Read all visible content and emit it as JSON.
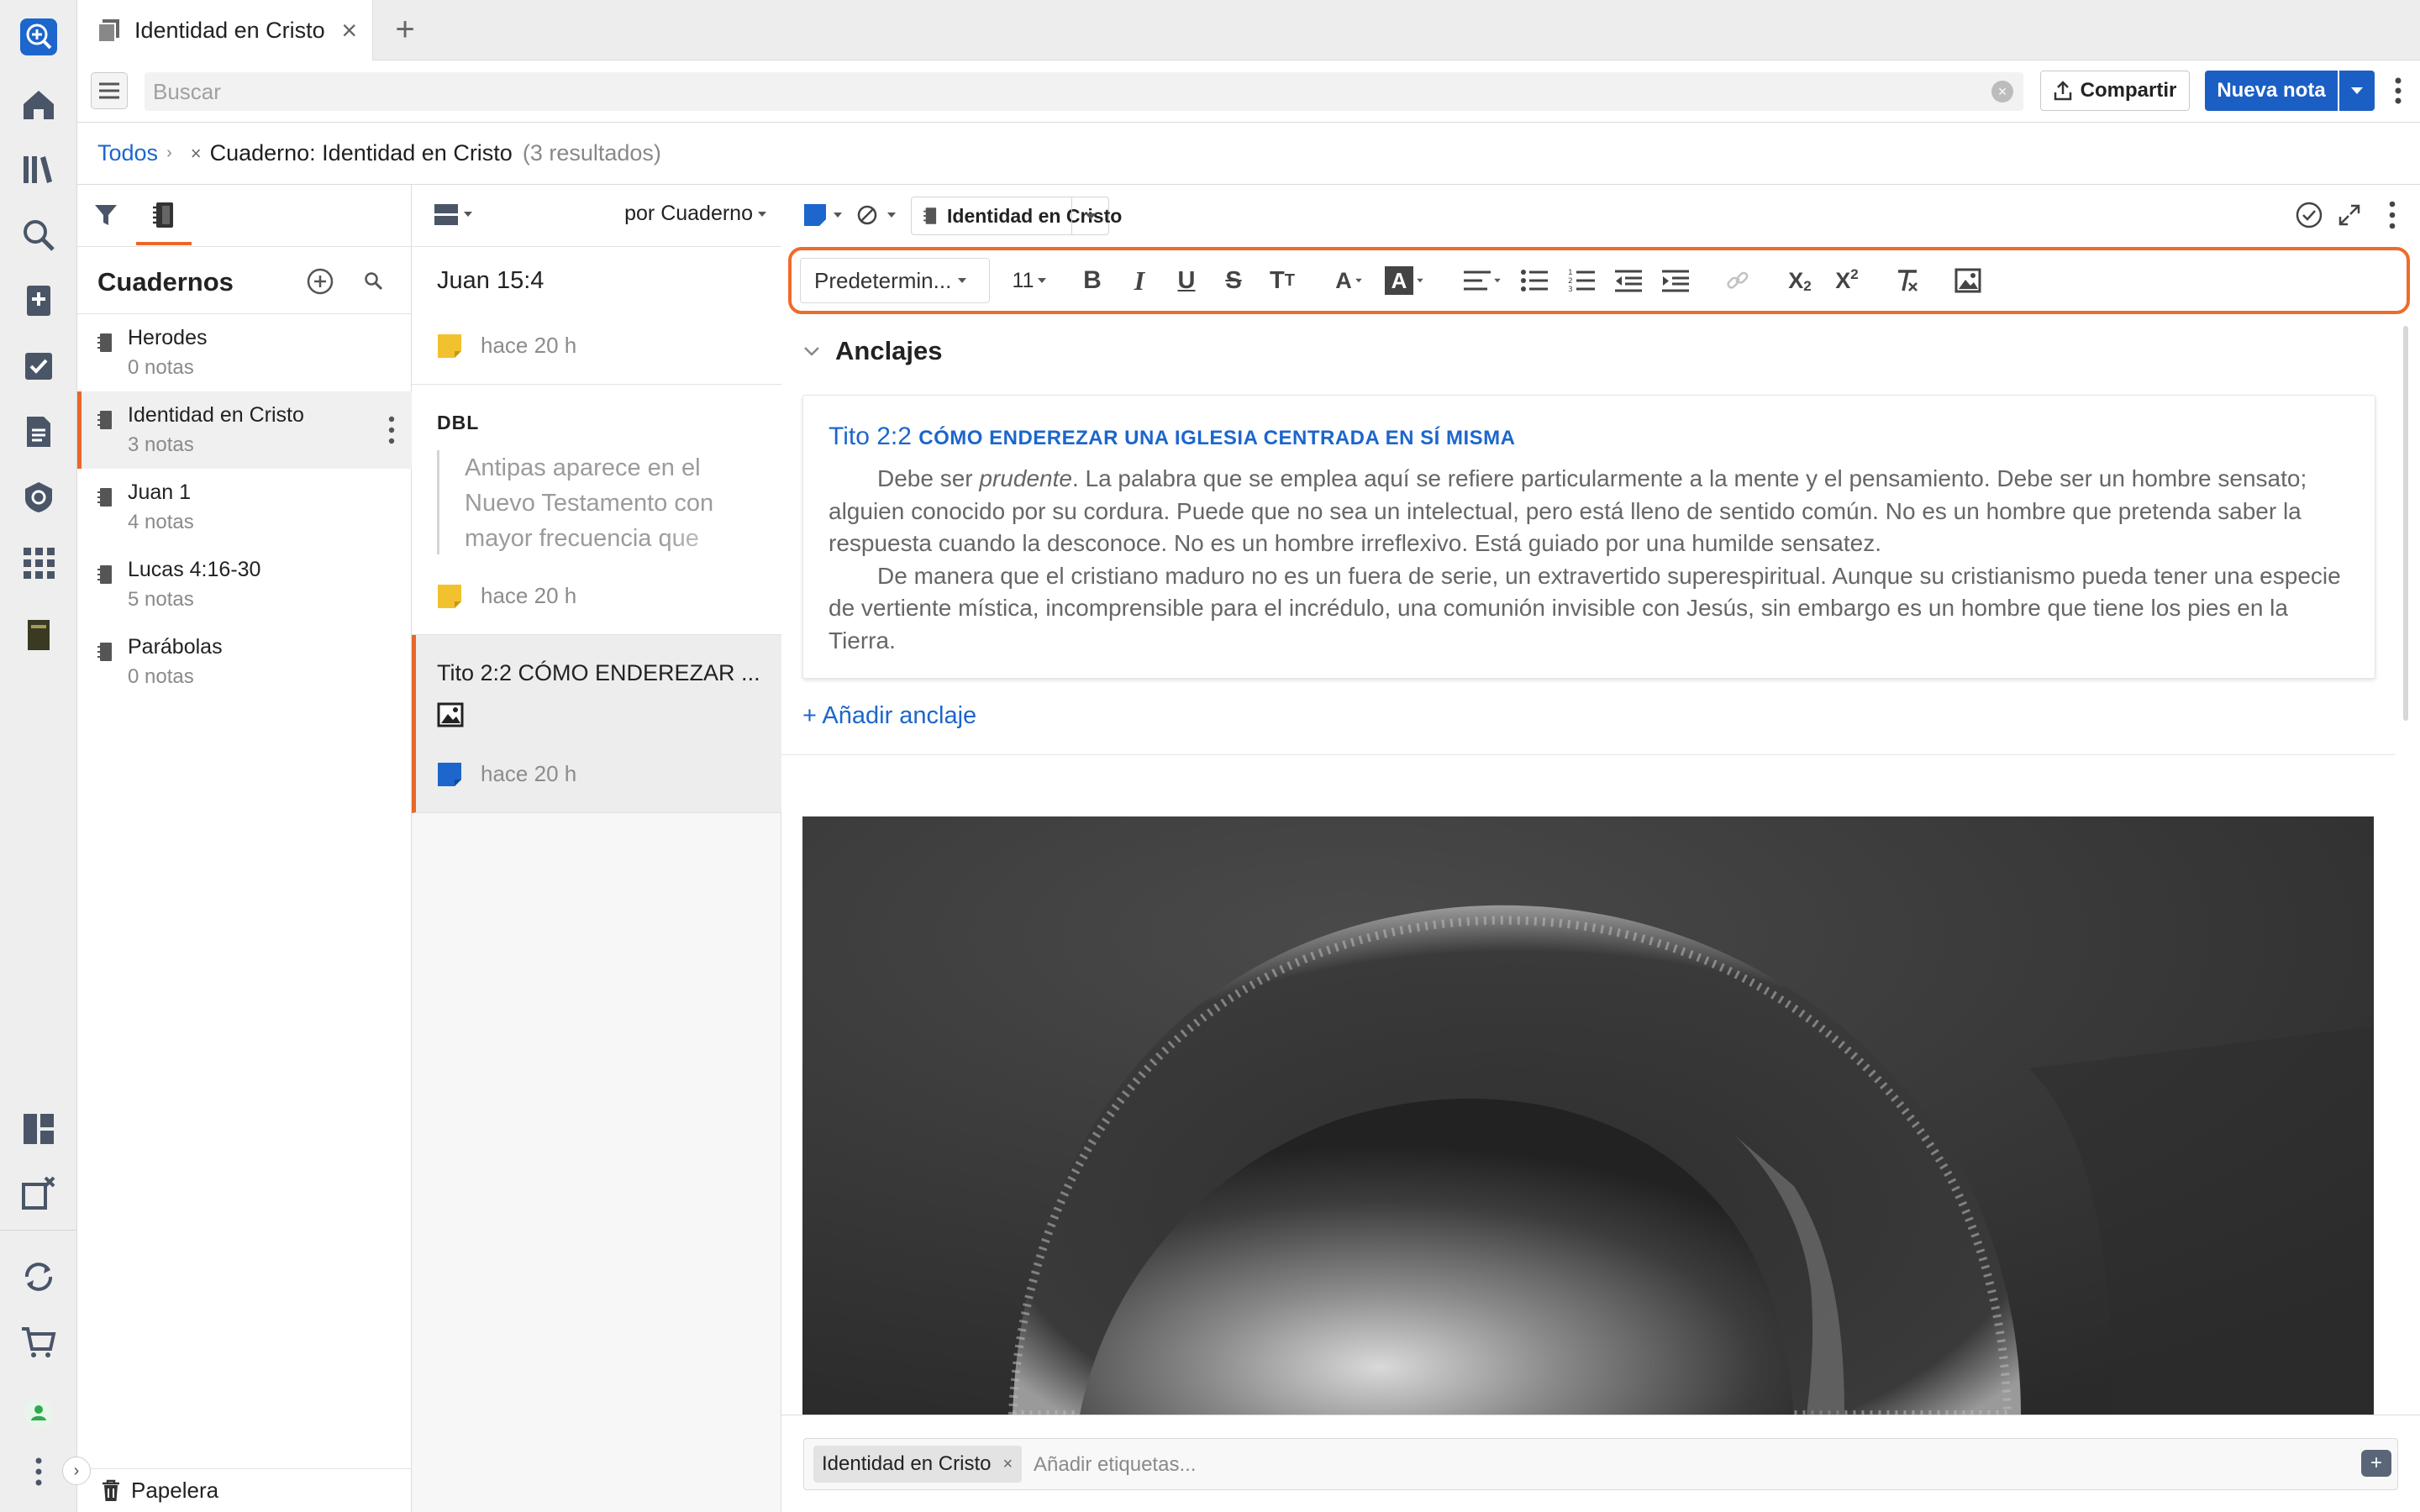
{
  "tab": {
    "title": "Identidad en Cristo",
    "close": "×",
    "add": "+"
  },
  "search": {
    "placeholder": "Buscar",
    "clear": "×"
  },
  "actions": {
    "share": "Compartir",
    "new_note": "Nueva nota"
  },
  "breadcrumb": {
    "home": "Todos",
    "separator": "›",
    "remove": "×",
    "current": "Cuaderno: Identidad en Cristo",
    "count": "(3 resultados)"
  },
  "notebooks": {
    "title": "Cuadernos",
    "items": [
      {
        "name": "Herodes",
        "count": "0 notas"
      },
      {
        "name": "Identidad en Cristo",
        "count": "3 notas"
      },
      {
        "name": "Juan 1",
        "count": "4 notas"
      },
      {
        "name": "Lucas 4:16-30",
        "count": "5 notas"
      },
      {
        "name": "Parábolas",
        "count": "0 notas"
      }
    ],
    "trash": "Papelera"
  },
  "results": {
    "sort_label": "por Cuaderno",
    "cards": [
      {
        "title": "Juan 15:4",
        "time": "hace 20 h",
        "color": "#f2c12e"
      },
      {
        "label": "DBL",
        "excerpt": "Antipas aparece en el Nuevo Testamento con mayor frecuencia que",
        "time": "hace 20 h",
        "color": "#f2c12e"
      },
      {
        "title": "Tito 2:2 CÓMO ENDEREZAR ...",
        "time": "hace 20 h",
        "color": "#1c66cc"
      }
    ]
  },
  "editor": {
    "notebook_chip": "Identidad en Cristo",
    "font_style": "Predetermin...",
    "font_size": "11",
    "section_title": "Anclajes",
    "quote": {
      "ref": "Tito 2:2",
      "heading": "CÓMO ENDEREZAR UNA IGLESIA CENTRADA EN SÍ MISMA",
      "p1_before": "Debe ser ",
      "p1_italic": "prudente",
      "p1_after": ". La palabra que se emplea aquí se refiere particularmente a la mente y el pensamiento. Debe ser un hombre sensato; alguien conocido por su cordura. Puede que no sea un intelectual, pero está lleno de sentido común. No es un hombre que pretenda saber la respuesta cuando la desconoce. No es un hombre irreflexivo. Está guiado por una humilde sensatez.",
      "p2": "De manera que el cristiano maduro no es un fuera de serie, un extravertido superespiritual. Aunque su cristianismo pueda tener una especie de vertiente mística, incomprensible para el incrédulo, una comunión invisible con Jesús, sin embargo es un hombre que tiene los pies en la Tierra."
    },
    "add_anchor": "+ Añadir anclaje",
    "tags": {
      "chip": "Identidad en Cristo",
      "remove": "×",
      "placeholder": "Añadir etiquetas..."
    }
  },
  "colors": {
    "accent": "#1c5fc4",
    "highlight": "#ef6b2a",
    "link": "#1c66cc"
  }
}
